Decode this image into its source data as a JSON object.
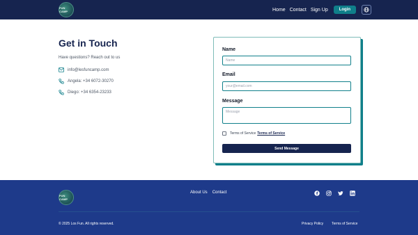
{
  "header": {
    "logo_text": "FUN CAMP",
    "nav": [
      "Home",
      "Contact",
      "Sign Up"
    ],
    "login_label": "Login",
    "language_icon": "globe-icon"
  },
  "contact": {
    "title": "Get in Touch",
    "subtitle": "Have questions? Reach out to us",
    "email": "info@lesfuncamp.com",
    "phone_1": "Angela: +34 6072-30270",
    "phone_2": "Diego: +34 6354-23233"
  },
  "form": {
    "name_label": "Name",
    "name_placeholder": "Name",
    "email_label": "Email",
    "email_placeholder": "your@email.com",
    "message_label": "Message",
    "message_placeholder": "Message",
    "terms_text": "Terms of Service",
    "terms_link": "Terms of Service",
    "submit_label": "Send Message"
  },
  "footer": {
    "logo_text": "FUN CAMP",
    "nav": [
      "About Us",
      "Contact"
    ],
    "socials": [
      "facebook-icon",
      "instagram-icon",
      "twitter-icon",
      "linkedin-icon"
    ],
    "copyright": "© 2025 Los Fun. All rights reserved.",
    "links": [
      "Privacy Policy",
      "Terms of Service"
    ]
  },
  "colors": {
    "header_bg": "#16244f",
    "accent": "#0f7f8a",
    "footer_bg": "#1e3a8a"
  }
}
